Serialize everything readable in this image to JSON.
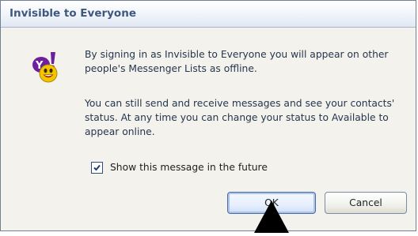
{
  "dialog": {
    "title": "Invisible to Everyone",
    "logo_icon": "yahoo-messenger-smiley-icon",
    "message_1": "By signing in as Invisible to Everyone you will appear on other people's Messenger Lists as offline.",
    "message_2": "You can still send and receive messages and see your contacts' status. At any time you can change your status to Available to appear online.",
    "checkbox": {
      "label": "Show this message in the future",
      "checked": true
    },
    "buttons": {
      "ok_label": "OK",
      "cancel_label": "Cancel"
    }
  },
  "colors": {
    "title_text": "#3e577e",
    "body_text": "#26364f",
    "dialog_background": "#f3f2ec",
    "logo_purple": "#6d1f9e",
    "logo_yellow": "#f5c400"
  },
  "pointer_icon": "black-arrow-cursor-icon"
}
